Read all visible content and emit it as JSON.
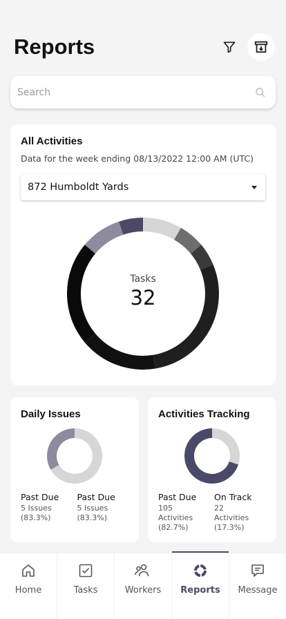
{
  "header": {
    "title": "Reports"
  },
  "search": {
    "placeholder": "Search"
  },
  "all_activities": {
    "title": "All Activities",
    "subtitle": "Data for the week ending 08/13/2022 12:00 AM (UTC)",
    "location": "872 Humboldt Yards",
    "center_label": "Tasks",
    "center_value": "32"
  },
  "daily_issues": {
    "title": "Daily Issues",
    "stats": [
      {
        "heading": "Past Due",
        "count": "5 Issues",
        "percent": "(83.3%)"
      },
      {
        "heading": "Past Due",
        "count": "5 Issues",
        "percent": "(83.3%)"
      }
    ]
  },
  "activities_tracking": {
    "title": "Activities Tracking",
    "stats": [
      {
        "heading": "Past Due",
        "count": "105",
        "unit": "Activities",
        "percent": "(82.7%)"
      },
      {
        "heading": "On Track",
        "count": "22",
        "unit": "Activities",
        "percent": "(17.3%)"
      }
    ]
  },
  "tabs": [
    {
      "label": "Home",
      "icon": "home-icon"
    },
    {
      "label": "Tasks",
      "icon": "tasks-icon"
    },
    {
      "label": "Workers",
      "icon": "workers-icon"
    },
    {
      "label": "Reports",
      "icon": "reports-icon",
      "active": true
    },
    {
      "label": "Message",
      "icon": "message-icon"
    }
  ],
  "colors": {
    "accent": "#4a4a68",
    "main_donut_segments": [
      "#4a4a68",
      "#d6d6d6",
      "#6e6e6e",
      "#3a3a3a",
      "#1f1f1f",
      "#111111",
      "#0a0a0a",
      "#8c8c9e"
    ],
    "daily_donut": [
      "#8c8c9e",
      "#d6d6d6"
    ],
    "tracking_donut": [
      "#4a4a68",
      "#d6d6d6"
    ]
  }
}
